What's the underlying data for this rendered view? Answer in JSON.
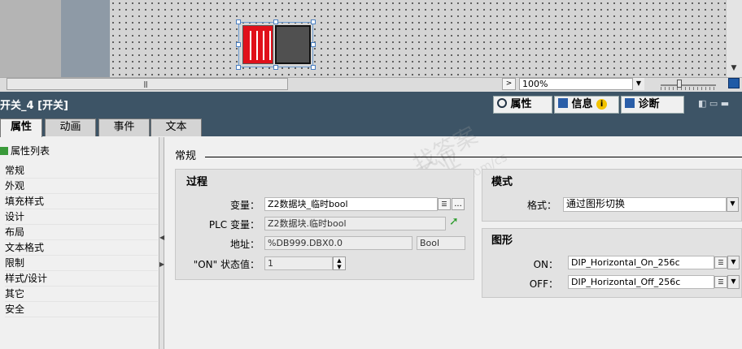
{
  "canvas": {
    "zoom": "100%",
    "grip": "|||",
    "arrow_right": ">",
    "arrow_down": "▼"
  },
  "inspector": {
    "title": "开关_4 [开关]",
    "tabs": [
      {
        "label": "属性",
        "icon": "properties-icon"
      },
      {
        "label": "信息",
        "icon": "info-icon"
      },
      {
        "label": "诊断",
        "icon": "diagnostics-icon"
      }
    ],
    "info_badge": "i",
    "window_icons": "◧ ▭ ▬"
  },
  "subtabs": [
    "属性",
    "动画",
    "事件",
    "文本"
  ],
  "nav": {
    "header": "属性列表",
    "items": [
      "常规",
      "外观",
      "填充样式",
      "设计",
      "布局",
      "文本格式",
      "限制",
      "样式/设计",
      "其它",
      "安全"
    ]
  },
  "general": {
    "section_title": "常规",
    "process": {
      "title": "过程",
      "variable_label": "变量：",
      "variable_value": "Z2数据块_临时bool",
      "plc_variable_label": "PLC 变量：",
      "plc_variable_value": "Z2数据块.临时bool",
      "address_label": "地址：",
      "address_value": "%DB999.DBX0.0",
      "address_type": "Bool",
      "on_state_label": "\"ON\" 状态值：",
      "on_state_value": "1",
      "browse_label": "...",
      "list_icon": "☰",
      "link_arrow": "➚"
    },
    "mode": {
      "title": "模式",
      "format_label": "格式：",
      "format_value": "通过图形切换"
    },
    "graphics": {
      "title": "图形",
      "on_label": "ON：",
      "on_value": "DIP_Horizontal_On_256c",
      "off_label": "OFF：",
      "off_value": "DIP_Horizontal_Off_256c"
    }
  },
  "watermark": {
    "line1": "找答案",
    "line2": "support.industry.siemens.com/cs",
    "line3": "西门子工业"
  },
  "colors": {
    "header_bg": "#3d5466",
    "switch_red": "#e0101a",
    "switch_dark": "#505050"
  }
}
